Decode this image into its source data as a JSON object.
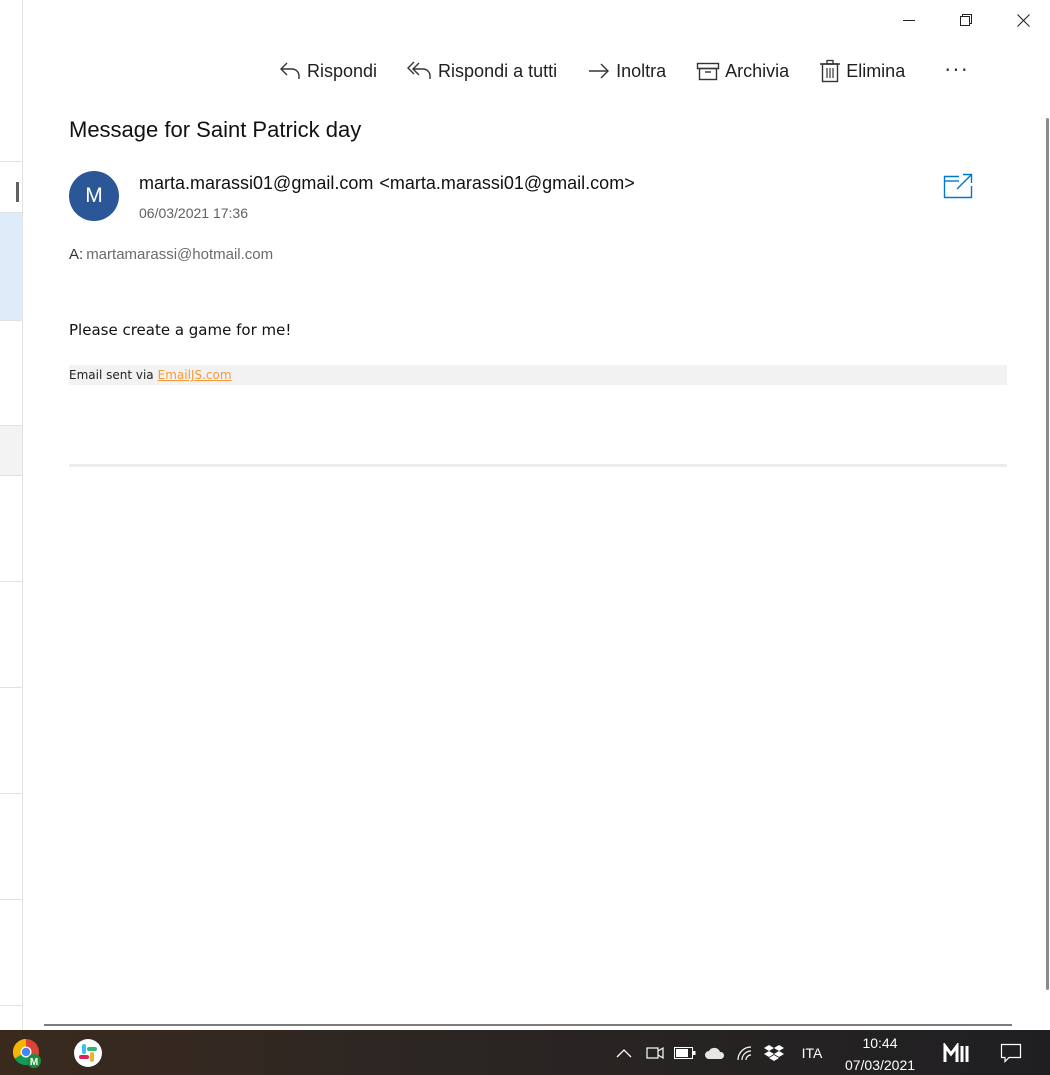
{
  "window": {
    "controls": {
      "minimize": "minimize",
      "restore": "restore",
      "close": "close"
    }
  },
  "toolbar": {
    "reply_label": "Rispondi",
    "reply_all_label": "Rispondi a tutti",
    "forward_label": "Inoltra",
    "archive_label": "Archivia",
    "delete_label": "Elimina",
    "more_label": "···"
  },
  "message": {
    "subject": "Message for Saint Patrick day",
    "avatar_initial": "M",
    "sender_name": "marta.marassi01@gmail.com",
    "sender_address": "<marta.marassi01@gmail.com>",
    "date": "06/03/2021 17:36",
    "to_label": "A:",
    "to_address": "martamarassi@hotmail.com",
    "body": "Please create a game for me!",
    "footer_text": "Email sent via",
    "footer_link": "EmailJS.com"
  },
  "taskbar": {
    "language": "ITA",
    "time": "10:44",
    "date": "07/03/2021"
  },
  "colors": {
    "avatar": "#2b5797",
    "accent": "#0078d4",
    "link": "#f59a3a",
    "selected_item": "#deecf9"
  }
}
